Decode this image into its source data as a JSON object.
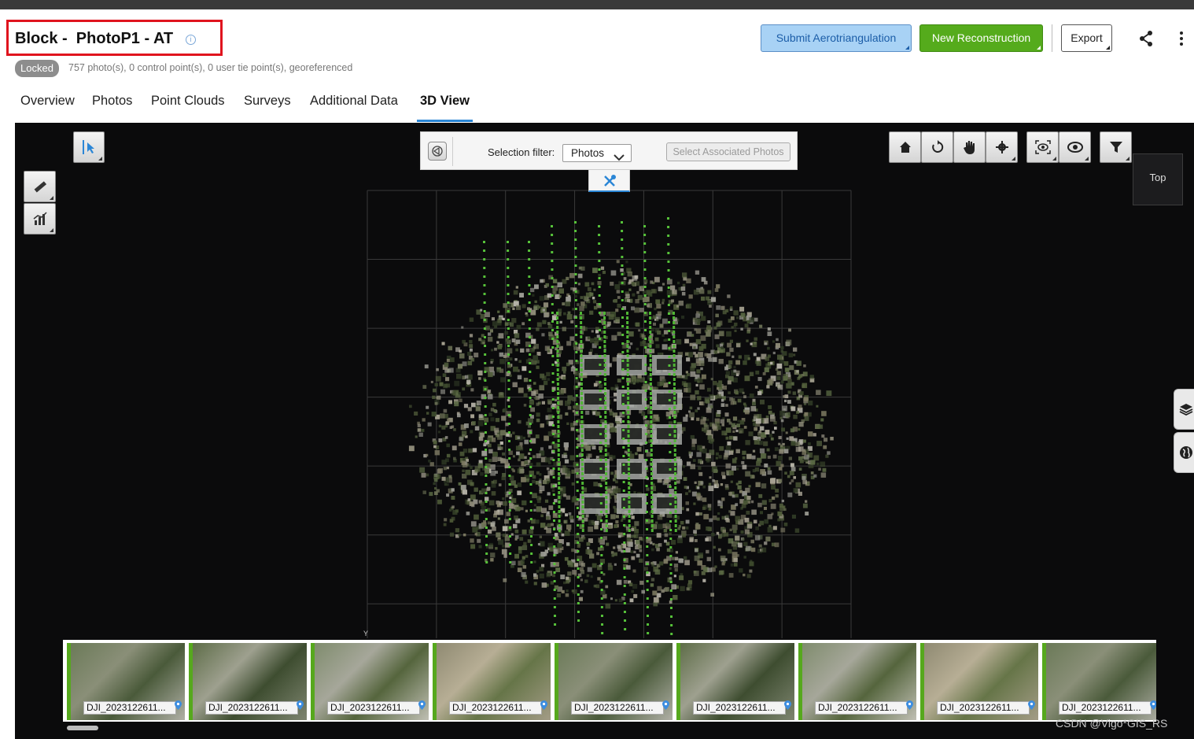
{
  "header": {
    "title": "Block -  PhotoP1 - AT",
    "badge": "Locked",
    "summary": "757 photo(s), 0 control point(s), 0 user tie point(s), georeferenced",
    "buttons": {
      "submit": "Submit Aerotriangulation",
      "new_reconstruction": "New Reconstruction",
      "export": "Export"
    }
  },
  "tabs": [
    {
      "label": "Overview"
    },
    {
      "label": "Photos"
    },
    {
      "label": "Point Clouds"
    },
    {
      "label": "Surveys"
    },
    {
      "label": "Additional Data"
    },
    {
      "label": "3D View",
      "active": true
    }
  ],
  "viewer": {
    "selection_filter_label": "Selection filter:",
    "selection_filter_value": "Photos",
    "select_associated": "Select Associated Photos",
    "view_label": "Top",
    "axis_label": "Y",
    "left_tools": [
      "select-icon",
      "ruler-icon",
      "chart-icon"
    ],
    "right_tools": [
      "home-icon",
      "rotate-icon",
      "pan-icon",
      "settings-icon",
      "focus-icon",
      "eye-icon",
      "filter-icon"
    ],
    "side_tabs": [
      "layers-icon",
      "globe-icon"
    ]
  },
  "filmstrip": {
    "photos": [
      "DJI_2023122611...",
      "DJI_2023122611...",
      "DJI_2023122611...",
      "DJI_2023122611...",
      "DJI_2023122611...",
      "DJI_2023122611...",
      "DJI_2023122611...",
      "DJI_2023122611...",
      "DJI_2023122611..."
    ]
  },
  "watermark": "CSDN @Vigo*GIS_RS",
  "colors": {
    "accent": "#2b86d6",
    "primary_green": "#55ab1c",
    "submit_blue": "#a8d2f5",
    "highlight_red": "#e0141e",
    "camera_points": "#57c23a"
  }
}
